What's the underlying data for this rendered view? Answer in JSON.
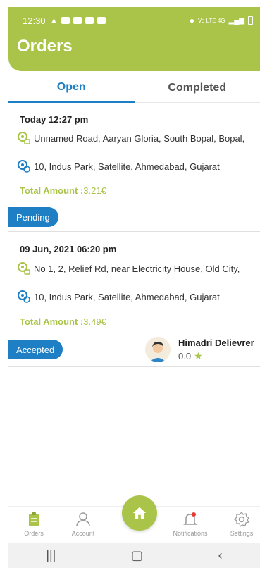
{
  "status_bar": {
    "time": "12:30",
    "network": "Vo LTE 4G"
  },
  "header": {
    "title": "Orders"
  },
  "tabs": [
    {
      "label": "Open",
      "active": true
    },
    {
      "label": "Completed",
      "active": false
    }
  ],
  "orders": [
    {
      "date": "Today 12:27 pm",
      "pickup": "Unnamed Road, Aaryan Gloria, South Bopal, Bopal,",
      "dropoff": "10, Indus Park, Satellite, Ahmedabad, Gujarat",
      "amount_label": "Total Amount :",
      "amount_value": "3.21€",
      "status": "Pending"
    },
    {
      "date": "09 Jun, 2021 06:20 pm",
      "pickup": "No 1, 2, Relief Rd, near Electricity House, Old City,",
      "dropoff": "10, Indus Park, Satellite, Ahmedabad, Gujarat",
      "amount_label": "Total Amount :",
      "amount_value": "3.49€",
      "status": "Accepted",
      "driver": {
        "name": "Himadri Delievrer",
        "rating": "0.0"
      }
    }
  ],
  "bottom_nav": {
    "orders": "Orders",
    "account": "Account",
    "notifications": "Notifications",
    "settings": "Settings"
  },
  "colors": {
    "brand_green": "#a9c448",
    "accent_blue": "#1f7fc5"
  }
}
